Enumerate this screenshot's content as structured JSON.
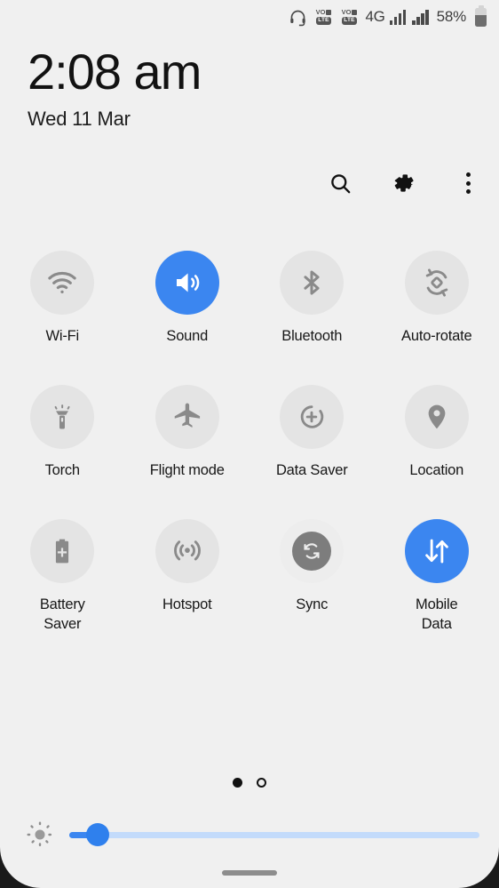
{
  "statusbar": {
    "headset_icon": "headset-icon",
    "volte_slots": [
      {
        "top": "VO",
        "bottom": "LTE"
      },
      {
        "top": "VO",
        "bottom": "LTE"
      }
    ],
    "network_type": "4G",
    "signal_bars": [
      4,
      4
    ],
    "battery_percent": "58%",
    "battery_level": 58
  },
  "clock": {
    "time": "2:08 am",
    "date": "Wed 11 Mar"
  },
  "toolbar": {
    "search_label": "search-icon",
    "settings_label": "gear-icon",
    "overflow_label": "more-vertical-icon"
  },
  "tiles": [
    {
      "id": "wifi",
      "label": "Wi-Fi",
      "icon": "wifi-icon",
      "active": false
    },
    {
      "id": "sound",
      "label": "Sound",
      "icon": "volume-icon",
      "active": true
    },
    {
      "id": "bluetooth",
      "label": "Bluetooth",
      "icon": "bluetooth-icon",
      "active": false
    },
    {
      "id": "auto-rotate",
      "label": "Auto-rotate",
      "icon": "auto-rotate-icon",
      "active": false
    },
    {
      "id": "torch",
      "label": "Torch",
      "icon": "flashlight-icon",
      "active": false
    },
    {
      "id": "flight-mode",
      "label": "Flight mode",
      "icon": "airplane-icon",
      "active": false
    },
    {
      "id": "data-saver",
      "label": "Data Saver",
      "icon": "data-saver-icon",
      "active": false
    },
    {
      "id": "location",
      "label": "Location",
      "icon": "location-pin-icon",
      "active": false
    },
    {
      "id": "battery-saver",
      "label": "Battery\nSaver",
      "icon": "battery-plus-icon",
      "active": false
    },
    {
      "id": "hotspot",
      "label": "Hotspot",
      "icon": "hotspot-icon",
      "active": false
    },
    {
      "id": "sync",
      "label": "Sync",
      "icon": "sync-icon",
      "active": false
    },
    {
      "id": "mobile-data",
      "label": "Mobile\nData",
      "icon": "mobile-data-icon",
      "active": true
    }
  ],
  "pager": {
    "total_pages": 2,
    "current_page": 1
  },
  "brightness": {
    "icon": "brightness-icon",
    "value_percent": 7
  },
  "navigation": {
    "home_bar": "home-gesture-bar"
  },
  "colors": {
    "accent": "#3b86f0",
    "background": "#f0f0f0",
    "tile_inactive": "#e4e4e4",
    "icon_gray": "#8a8a8a",
    "track_inactive": "#c3dbfb"
  }
}
